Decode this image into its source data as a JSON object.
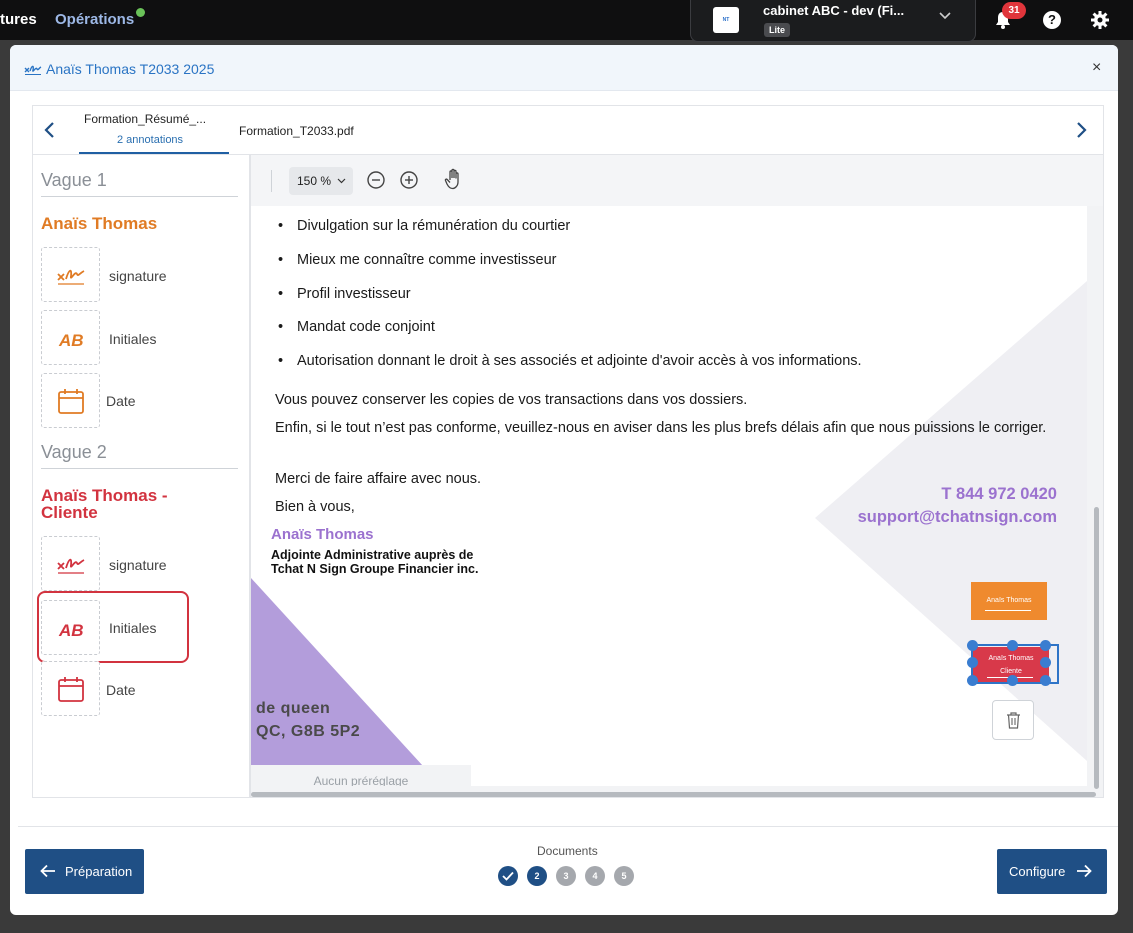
{
  "topbar": {
    "nav_partial": "tures",
    "nav_operations": "Opérations",
    "cabinet_name": "cabinet ABC - dev (Fi...",
    "cabinet_plan": "Lite",
    "cabinet_logo_text": "NT",
    "notifications_count": "31",
    "help_label": "?"
  },
  "modal": {
    "title": "Anaïs Thomas T2033 2025",
    "close_label": "×"
  },
  "tabs": [
    {
      "label": "Formation_Résumé_...",
      "sub": "2 annotations"
    },
    {
      "label": "Formation_T2033.pdf"
    }
  ],
  "left_panel": {
    "waves": [
      {
        "label": "Vague 1",
        "signer": "Anaïs Thomas",
        "signer_color": "#e07b24",
        "fields": [
          {
            "label": "signature"
          },
          {
            "label": "Initiales"
          },
          {
            "label": "Date"
          }
        ]
      },
      {
        "label": "Vague 2",
        "signer_line1": "Anaïs Thomas -",
        "signer_line2": "Cliente",
        "signer_color": "#d2333f",
        "fields": [
          {
            "label": "signature"
          },
          {
            "label": "Initiales"
          },
          {
            "label": "Date"
          }
        ]
      }
    ]
  },
  "viewer": {
    "zoom": "150 %",
    "bullets": [
      "Divulgation sur la rémunération du courtier",
      "Mieux me connaître comme investisseur",
      "Profil investisseur",
      "Mandat code conjoint",
      "Autorisation donnant le droit à ses associés et adjointe d'avoir accès à vos informations."
    ],
    "para1": "Vous pouvez conserver les copies de vos transactions dans vos dossiers.",
    "para2": "Enfin, si le tout n’est pas conforme, veuillez-nous en aviser dans les plus brefs délais afin que nous puissions le corriger.",
    "para3": "Merci de faire affaire avec nous.",
    "para4": "Bien à vous,",
    "sig_name": "Anaïs Thomas",
    "sig_role_1": "Adjointe Administrative auprès de",
    "sig_role_2": "Tchat N Sign Groupe Financier inc.",
    "phone": "T 844 972 0420",
    "email": "support@tchatnsign.com",
    "addr1": "de queen",
    "addr2": "QC, G8B 5P2",
    "stamp_orange": "Anaïs Thomas",
    "stamp_red_1": "Anaïs Thomas",
    "stamp_red_2": "Cliente",
    "preset": "Aucun préréglage"
  },
  "footer": {
    "prev_label": "Préparation",
    "next_label": "Configure",
    "documents_label": "Documents",
    "steps": [
      "",
      "2",
      "3",
      "4",
      "5"
    ]
  }
}
